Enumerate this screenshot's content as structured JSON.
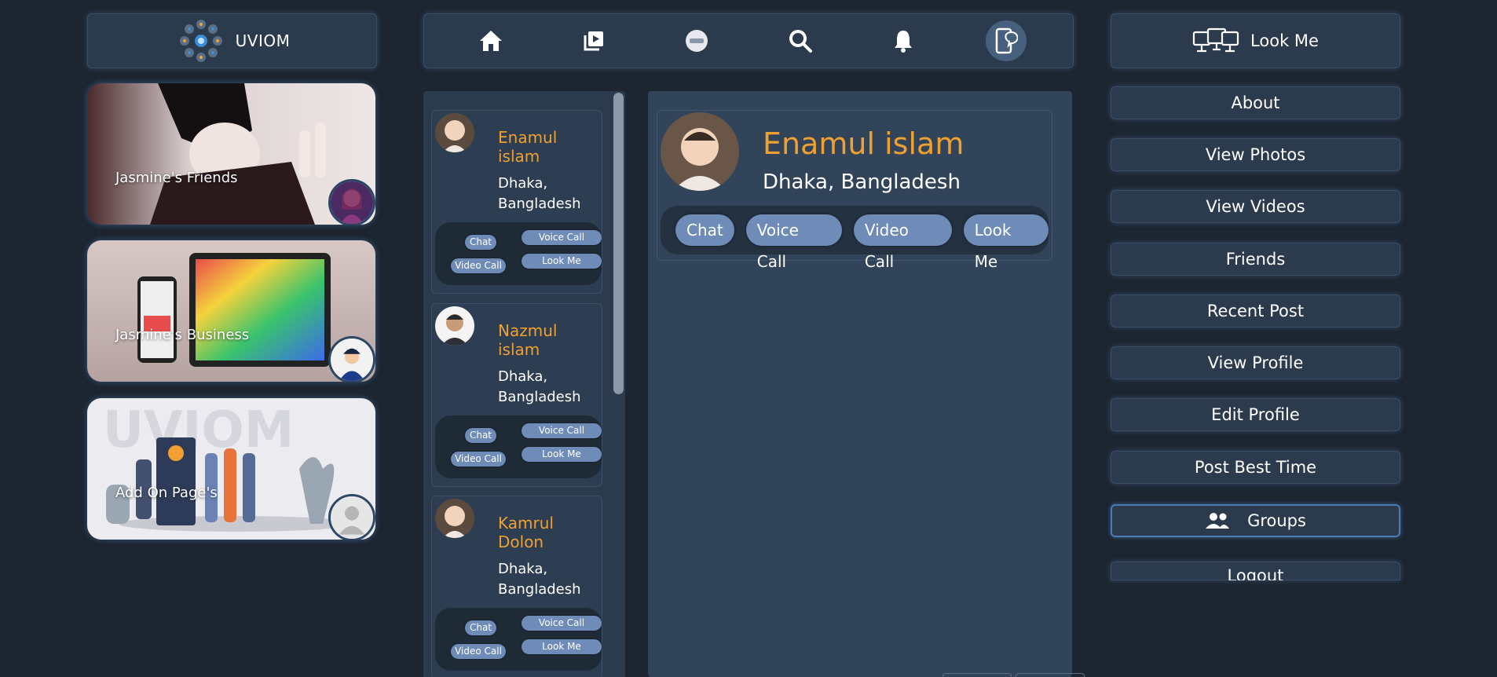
{
  "brand": {
    "name": "UVIOM"
  },
  "nav": {
    "items": [
      {
        "icon": "home-icon"
      },
      {
        "icon": "video-library-icon"
      },
      {
        "icon": "uviom-live-icon"
      },
      {
        "icon": "search-icon"
      },
      {
        "icon": "bell-icon"
      },
      {
        "icon": "phone-chat-icon",
        "active": true
      }
    ]
  },
  "cards": [
    {
      "label": "Jasmine's Friends"
    },
    {
      "label": "Jasmine's Business"
    },
    {
      "label": "Add On Page's"
    }
  ],
  "contacts": [
    {
      "name": "Enamul islam",
      "location": "Dhaka, Bangladesh",
      "chat": "Chat",
      "video": "Video Call",
      "voice": "Voice Call",
      "look": "Look Me"
    },
    {
      "name": "Nazmul islam",
      "location": "Dhaka, Bangladesh",
      "chat": "Chat",
      "video": "Video Call",
      "voice": "Voice Call",
      "look": "Look Me"
    },
    {
      "name": "Kamrul Dolon",
      "location": "Dhaka, Bangladesh",
      "chat": "Chat",
      "video": "Video Call",
      "voice": "Voice Call",
      "look": "Look Me"
    }
  ],
  "profile": {
    "name": "Enamul islam",
    "location": "Dhaka, Bangladesh",
    "actions": [
      "Chat",
      "Voice Call",
      "Video Call",
      "Look Me"
    ]
  },
  "right": {
    "title": "Look Me",
    "menu": [
      "About",
      "View Photos",
      "View Videos",
      "Friends",
      "Recent Post",
      "View Profile",
      "Edit Profile",
      "Post Best Time",
      "Groups",
      "Logout"
    ]
  },
  "colors": {
    "background": "#1c2530",
    "panel": "#2b3a4c",
    "accent_name": "#f0a030",
    "pill": "#6f8cb8"
  }
}
